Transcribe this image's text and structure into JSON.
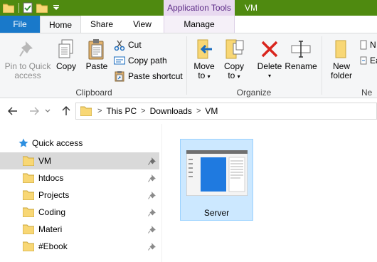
{
  "window": {
    "title": "VM",
    "context_tab": "Application Tools"
  },
  "tabs": {
    "file": "File",
    "home": "Home",
    "share": "Share",
    "view": "View",
    "manage": "Manage"
  },
  "ribbon": {
    "clipboard": {
      "label": "Clipboard",
      "pin_to_quick_access_line1": "Pin to Quick",
      "pin_to_quick_access_line2": "access",
      "copy": "Copy",
      "paste": "Paste",
      "cut": "Cut",
      "copy_path": "Copy path",
      "paste_shortcut": "Paste shortcut"
    },
    "organize": {
      "label": "Organize",
      "move_to_line1": "Move",
      "move_to_line2": "to",
      "copy_to_line1": "Copy",
      "copy_to_line2": "to",
      "delete": "Delete",
      "rename": "Rename"
    },
    "new": {
      "label": "Ne",
      "new_folder_line1": "New",
      "new_folder_line2": "folder",
      "new_item": "N",
      "easy_access": "Ea"
    }
  },
  "address": {
    "crumbs": [
      "This PC",
      "Downloads",
      "VM"
    ]
  },
  "navpane": {
    "quick_access": "Quick access",
    "items": [
      {
        "label": "VM",
        "pinned": true,
        "selected": true
      },
      {
        "label": "htdocs",
        "pinned": true
      },
      {
        "label": "Projects",
        "pinned": true
      },
      {
        "label": "Coding",
        "pinned": true
      },
      {
        "label": "Materi",
        "pinned": true
      },
      {
        "label": "#Ebook",
        "pinned": true
      }
    ]
  },
  "content": {
    "items": [
      {
        "label": "Server",
        "selected": true
      }
    ]
  },
  "colors": {
    "title_bar": "#4f8a10",
    "file_tab": "#1979ca",
    "context_tab_bg": "#e8d9f0",
    "selection": "#cce8ff",
    "folder_yellow": "#f8d775"
  }
}
